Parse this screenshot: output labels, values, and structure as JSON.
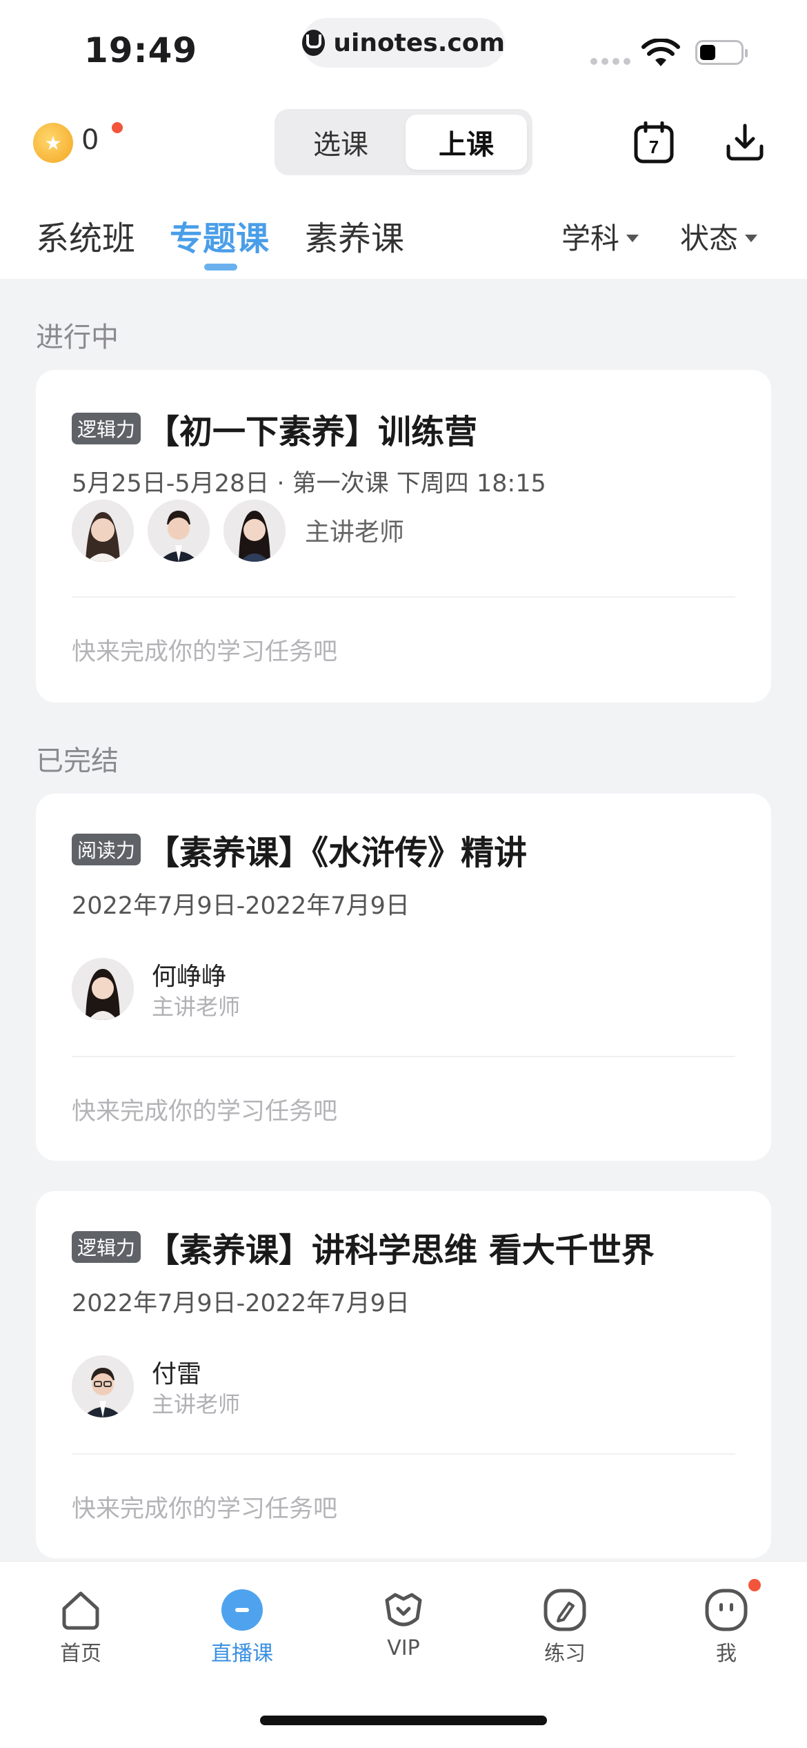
{
  "status_bar": {
    "time": "19:49",
    "url": "uinotes.com"
  },
  "header": {
    "coin_count": "0",
    "segment": {
      "options": [
        "选课",
        "上课"
      ],
      "active": "上课"
    },
    "calendar_day": "7"
  },
  "tabs": [
    {
      "label": "系统班"
    },
    {
      "label": "专题课",
      "active": true
    },
    {
      "label": "素养课"
    }
  ],
  "filters": [
    {
      "label": "学科"
    },
    {
      "label": "状态"
    }
  ],
  "sections": {
    "ongoing": {
      "title": "进行中",
      "card": {
        "badge": "逻辑力",
        "title": "【初一下素养】训练营",
        "date": "5月25日-5月28日 · 第一次课 下周四 18:15",
        "teacher_label": "主讲老师",
        "task": "快来完成你的学习任务吧"
      }
    },
    "finished": {
      "title": "已完结",
      "cards": [
        {
          "badge": "阅读力",
          "title": "【素养课】《水浒传》精讲",
          "date": "2022年7月9日-2022年7月9日",
          "teacher_name": "何峥峥",
          "teacher_role": "主讲老师",
          "task": "快来完成你的学习任务吧"
        },
        {
          "badge": "逻辑力",
          "title": "【素养课】讲科学思维 看大千世界",
          "date": "2022年7月9日-2022年7月9日",
          "teacher_name": "付雷",
          "teacher_role": "主讲老师",
          "task": "快来完成你的学习任务吧"
        }
      ]
    }
  },
  "tabbar": [
    {
      "label": "首页",
      "icon": "home-icon"
    },
    {
      "label": "直播课",
      "icon": "live-icon",
      "active": true
    },
    {
      "label": "VIP",
      "icon": "vip-icon"
    },
    {
      "label": "练习",
      "icon": "practice-icon"
    },
    {
      "label": "我",
      "icon": "me-icon"
    }
  ],
  "colors": {
    "accent": "#4a9ee8",
    "badge": "#5f6368",
    "dot": "#f2553b"
  }
}
